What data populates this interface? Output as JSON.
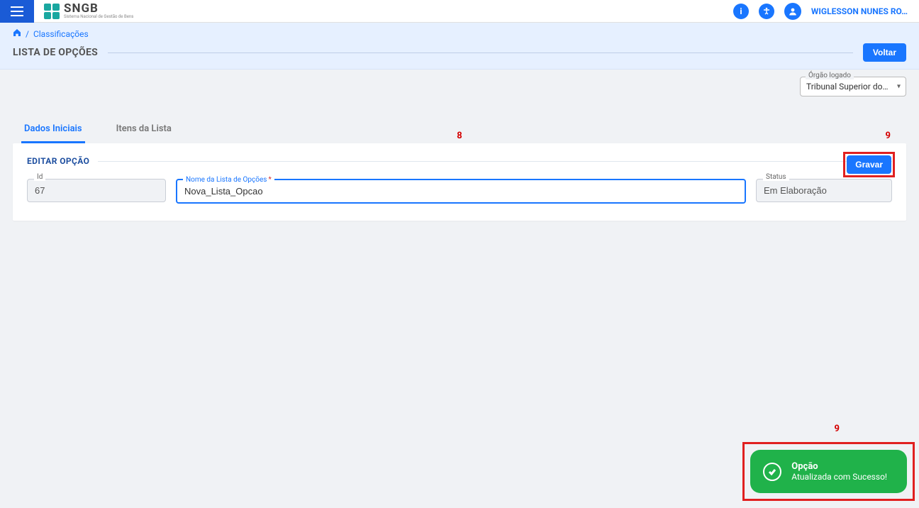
{
  "header": {
    "app_name": "SNGB",
    "app_tagline": "Sistema Nacional de Gestão de Bens",
    "user_name": "WIGLESSON NUNES RO…"
  },
  "breadcrumb": {
    "home_label": "",
    "separator": "/",
    "current": "Classificações"
  },
  "page": {
    "title": "LISTA DE OPÇÕES",
    "back_label": "Voltar"
  },
  "orgao": {
    "label": "Órgão logado",
    "value": "Tribunal Superior do Tra…"
  },
  "tabs": [
    {
      "label": "Dados Iniciais",
      "active": true
    },
    {
      "label": "Itens da Lista",
      "active": false
    }
  ],
  "section": {
    "title": "EDITAR OPÇÃO",
    "gravar_label": "Gravar"
  },
  "fields": {
    "id": {
      "label": "Id",
      "value": "67"
    },
    "nome": {
      "label": "Nome da Lista de Opções",
      "value": "Nova_Lista_Opcao"
    },
    "status": {
      "label": "Status",
      "value": "Em Elaboração"
    }
  },
  "annotations": {
    "marker_nome": "8",
    "marker_gravar": "9",
    "marker_toast": "9"
  },
  "toast": {
    "title": "Opção",
    "message": "Atualizada com Sucesso!"
  }
}
